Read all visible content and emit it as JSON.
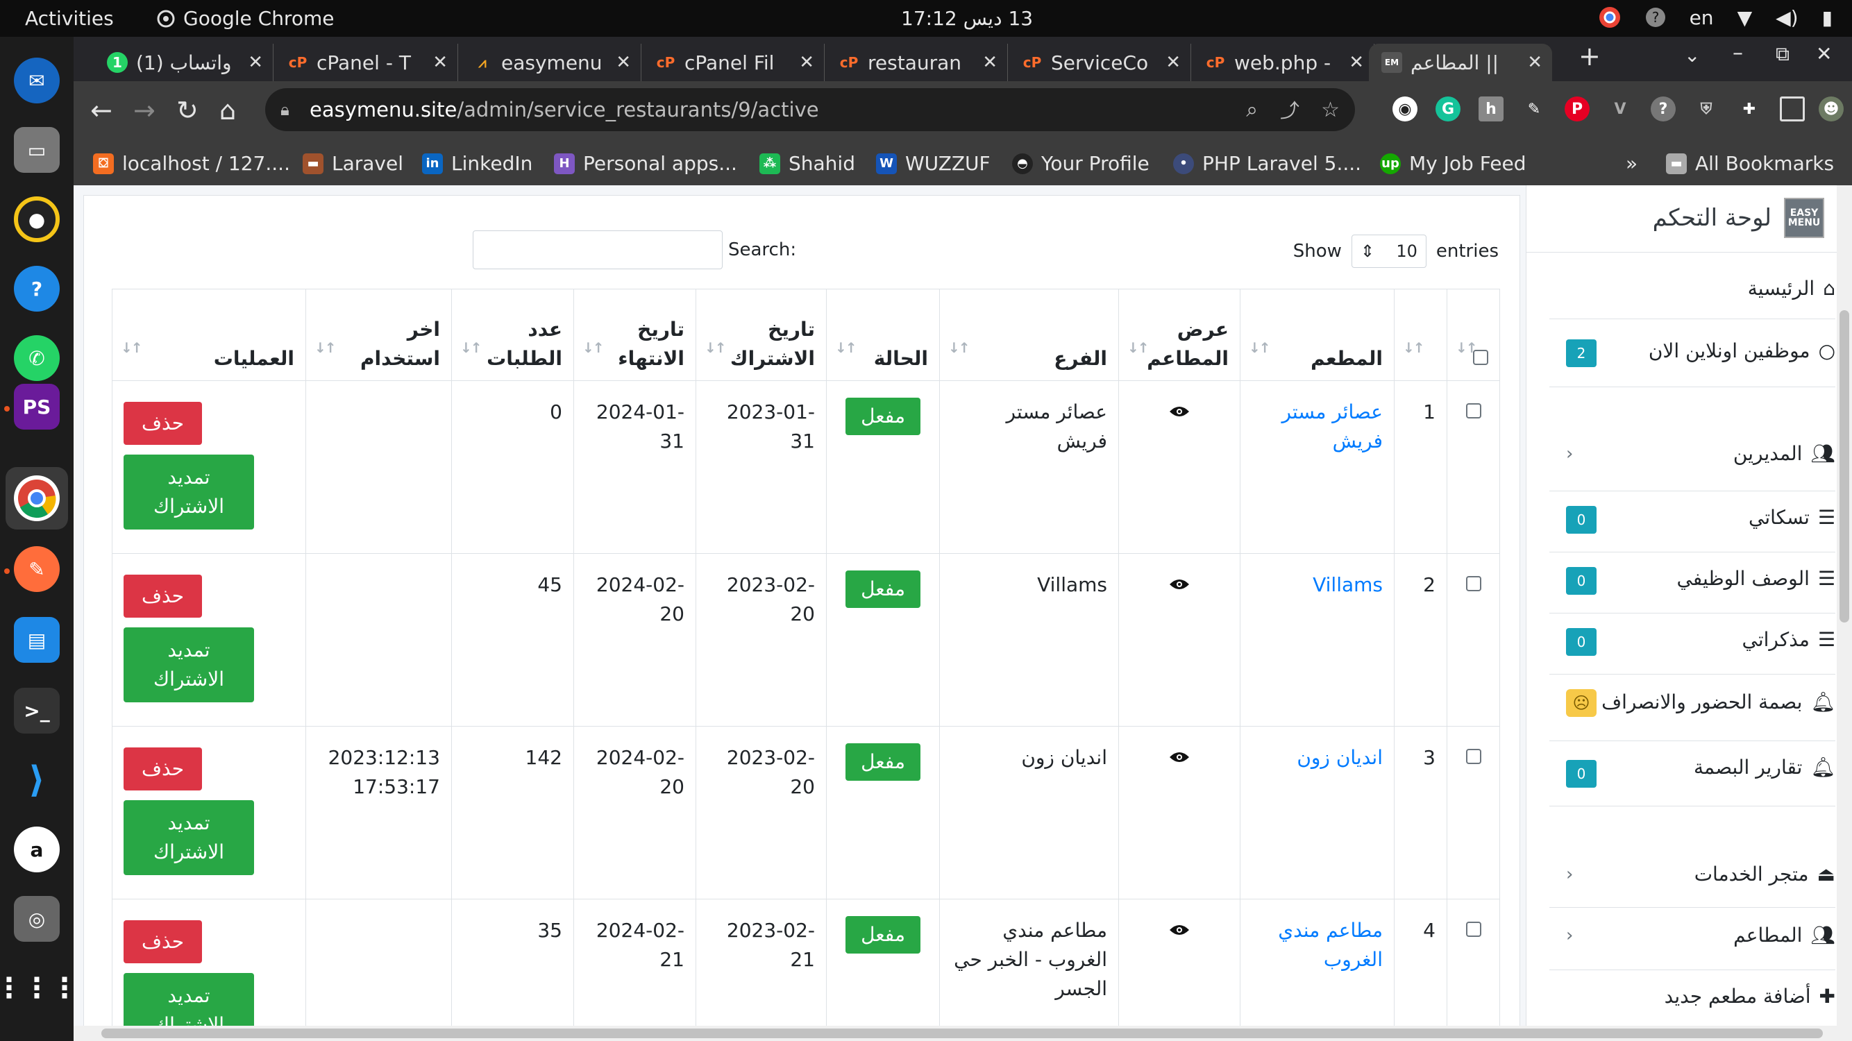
{
  "os": {
    "activities": "Activities",
    "app_name": "Google Chrome",
    "clock": "17:12 ‫13 ديس‬",
    "lang": "en"
  },
  "tabs": [
    {
      "label": "(1) واتساب",
      "badge": "1"
    },
    {
      "label": "cPanel - T"
    },
    {
      "label": "easymenu"
    },
    {
      "label": "cPanel Fil"
    },
    {
      "label": "restauran"
    },
    {
      "label": "ServiceCo"
    },
    {
      "label": "web.php -"
    },
    {
      "label": "المطاعم ||"
    }
  ],
  "address": {
    "host": "easymenu.site",
    "path": "/admin/service_restaurants/9/active"
  },
  "bookmarks": [
    "localhost / 127....",
    "Laravel",
    "LinkedIn",
    "Personal apps...",
    "Shahid",
    "WUZZUF",
    "Your Profile",
    "PHP Laravel 5....",
    "My Job Feed",
    "All Bookmarks"
  ],
  "controls": {
    "show": "Show",
    "entries_value": "10",
    "entries": "entries",
    "search": "Search:"
  },
  "table": {
    "headers": [
      "",
      "",
      "المطعم",
      "عرض المطاعم",
      "الفرع",
      "الحالة",
      "تاريخ الاشتراك",
      "تاريخ الانتهاء",
      "عدد الطلبات",
      "اخر استخدام",
      "العمليات"
    ],
    "rows": [
      {
        "id": "1",
        "restaurant": "عصائر مستر فريش",
        "branch": "عصائر مستر فريش",
        "status": "مفعل",
        "start": "2023-01-31",
        "end": "2024-01-31",
        "orders": "0",
        "last_use": ""
      },
      {
        "id": "2",
        "restaurant": "Villams",
        "branch": "Villams",
        "status": "مفعل",
        "start": "2023-02-20",
        "end": "2024-02-20",
        "orders": "45",
        "last_use": ""
      },
      {
        "id": "3",
        "restaurant": "انديان زون",
        "branch": "انديان زون",
        "status": "مفعل",
        "start": "2023-02-20",
        "end": "2024-02-20",
        "orders": "142",
        "last_use": "2023:12:13 17:53:17"
      },
      {
        "id": "4",
        "restaurant": "مطاعم مندي الغروب",
        "branch": "مطاعم مندي الغروب - الخبر حي الجسر",
        "status": "مفعل",
        "start": "2023-02-21",
        "end": "2024-02-21",
        "orders": "35",
        "last_use": ""
      }
    ],
    "delete_label": "حذف",
    "extend_label": "تمديد الاشتراك"
  },
  "sidebar": {
    "brand": "لوحة التحكم",
    "logo_text": "EASY MENU",
    "items": [
      {
        "label": "الرئيسية",
        "icon": "home-icon"
      },
      {
        "label": "موظفين اونلاين الان",
        "icon": "circle-icon",
        "count": "2"
      },
      {
        "label": "المديرين",
        "icon": "users-icon"
      },
      {
        "label": "تسكاتي",
        "icon": "list-icon",
        "count": "0"
      },
      {
        "label": "الوصف الوظيفي",
        "icon": "list-icon",
        "count": "0"
      },
      {
        "label": "مذكراتي",
        "icon": "list-icon",
        "count": "0"
      },
      {
        "label": "بصمة الحضور والانصراف",
        "icon": "bell-icon"
      },
      {
        "label": "تقارير البصمة",
        "icon": "bell-icon",
        "count": "0"
      },
      {
        "label": "متجر الخدمات",
        "icon": "service-bell-icon"
      },
      {
        "label": "المطاعم",
        "icon": "users-icon"
      },
      {
        "label": "أضافة مطعم جديد",
        "icon": "plus-icon"
      }
    ]
  },
  "colors": {
    "green": "#28a745",
    "red": "#dc3545",
    "info": "#17a2b8",
    "link": "#007bff"
  }
}
